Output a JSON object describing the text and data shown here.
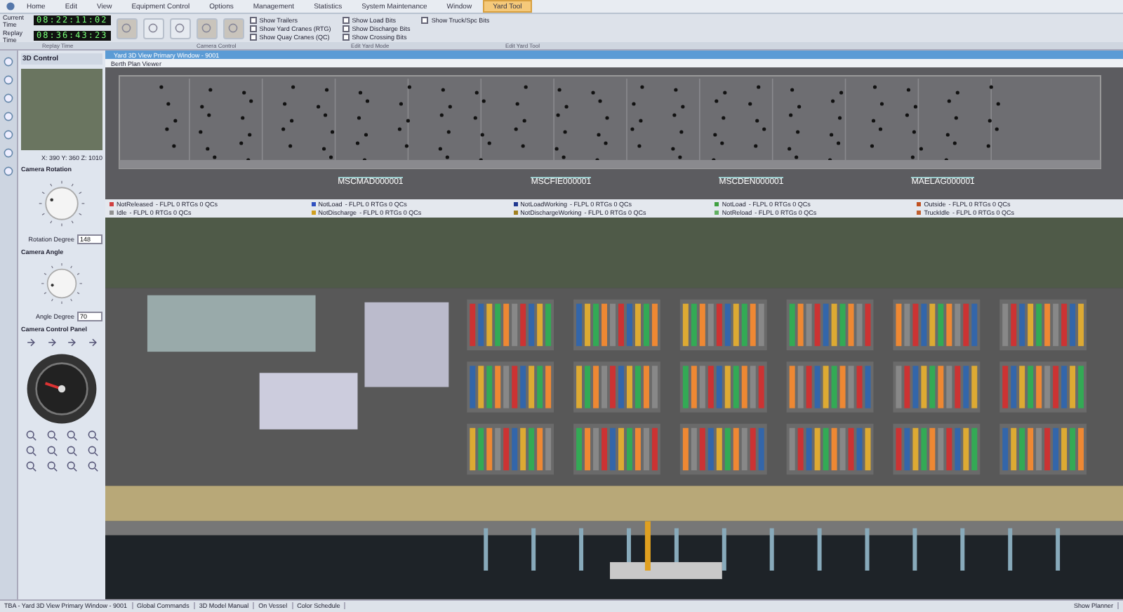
{
  "menu_tabs": [
    {
      "label": "Home",
      "selected": false
    },
    {
      "label": "Edit",
      "selected": false
    },
    {
      "label": "View",
      "selected": false
    },
    {
      "label": "Equipment Control",
      "selected": false
    },
    {
      "label": "Options",
      "selected": false
    },
    {
      "label": "Management",
      "selected": false
    },
    {
      "label": "Statistics",
      "selected": false
    },
    {
      "label": "System Maintenance",
      "selected": false
    },
    {
      "label": "Window",
      "selected": false
    },
    {
      "label": "Yard Tool",
      "selected": true
    }
  ],
  "clocks": [
    {
      "label": "Current Time",
      "value": "08:22:11:02"
    },
    {
      "label": "Replay Time",
      "value": "08:36:43:23"
    }
  ],
  "ribbon_groups": [
    "Replay Time",
    "Camera Control",
    "Edit Yard Mode",
    "Edit Yard Tool"
  ],
  "checkboxes": [
    {
      "label": "Show Trailers",
      "checked": false
    },
    {
      "label": "Show Yard Cranes (RTG)",
      "checked": false
    },
    {
      "label": "Show Quay Cranes (QC)",
      "checked": false
    },
    {
      "label": "Show Load Bits",
      "checked": false
    },
    {
      "label": "Show Discharge Bits",
      "checked": false
    },
    {
      "label": "Show Crossing Bits",
      "checked": false
    },
    {
      "label": "Show Truck/Spc Bits",
      "checked": false
    }
  ],
  "window": {
    "title": "Yard 3D View Primary Window - 9001"
  },
  "berth_plan": {
    "title": "Berth Plan Viewer",
    "vessels": [
      "MSCMAD000001",
      "MSCFIE000001",
      "MSCDEN000001",
      "MAELAG000001"
    ]
  },
  "legend": [
    {
      "label": "NotReleased",
      "color": "#d04040",
      "stats": "- FLPL   0 RTGs   0 QCs"
    },
    {
      "label": "NotLoad",
      "color": "#3050c0",
      "stats": "- FLPL   0 RTGs   0 QCs"
    },
    {
      "label": "NotLoadWorking",
      "color": "#203890",
      "stats": "- FLPL   0 RTGs   0 QCs"
    },
    {
      "label": "NotLoad",
      "color": "#40a040",
      "stats": "- FLPL   0 RTGs   0 QCs"
    },
    {
      "label": "Outside",
      "color": "#c05020",
      "stats": "- FLPL   0 RTGs   0 QCs"
    },
    {
      "label": "Idle",
      "color": "#909090",
      "stats": "- FLPL   0 RTGs   0 QCs"
    },
    {
      "label": "NotDischarge",
      "color": "#d0a020",
      "stats": "- FLPL   0 RTGs   0 QCs"
    },
    {
      "label": "NotDischargeWorking",
      "color": "#a08020",
      "stats": "- FLPL   0 RTGs   0 QCs"
    },
    {
      "label": "NotReload",
      "color": "#60b060",
      "stats": "- FLPL   0 RTGs   0 QCs"
    },
    {
      "label": "TruckIdle",
      "color": "#c06030",
      "stats": "- FLPL   0 RTGs   0 QCs"
    }
  ],
  "left_panel": {
    "title": "3D Control",
    "coords": "X: 390   Y: 360   Z: 1010",
    "rotation": {
      "title": "Camera Rotation",
      "label": "Rotation Degree",
      "value": "148"
    },
    "angle": {
      "title": "Camera Angle",
      "label": "Angle Degree",
      "value": "70"
    },
    "control_title": "Camera Control Panel"
  },
  "status_bar": [
    "TBA - Yard 3D View Primary Window - 9001",
    "Global Commands",
    "3D Model Manual",
    "On Vessel",
    "Color Schedule",
    "Show Planner"
  ]
}
